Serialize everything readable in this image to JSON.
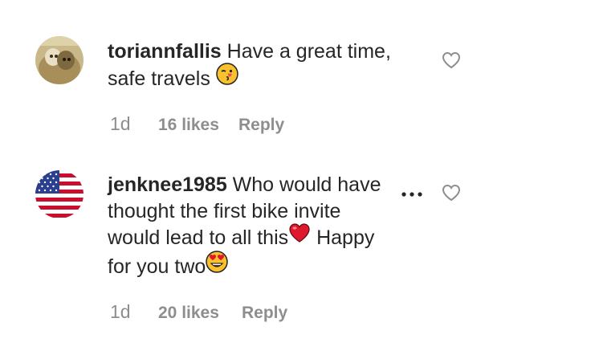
{
  "comments": [
    {
      "username": "toriannfallis",
      "text_line1": " Have a great time,",
      "text_line2": "safe travels ",
      "emoji": "kissing-face-emoji",
      "time": "1d",
      "likes": "16 likes",
      "reply": "Reply",
      "avatar_icon": "dogs-avatar"
    },
    {
      "username": "jenknee1985",
      "text_line1": " Who would have",
      "text_line2": "thought the first bike invite",
      "text_line3": "would lead to all this",
      "text_line3b": " Happy",
      "text_line4": "for you two",
      "emoji1": "red-heart-emoji",
      "emoji2": "heart-eyes-emoji",
      "time": "1d",
      "likes": "20 likes",
      "reply": "Reply",
      "avatar_icon": "us-flag-avatar"
    }
  ],
  "colors": {
    "text": "#262626",
    "secondary": "#8e8e8e",
    "heart": "#ed4956",
    "emoji_yellow": "#f9c12e"
  }
}
